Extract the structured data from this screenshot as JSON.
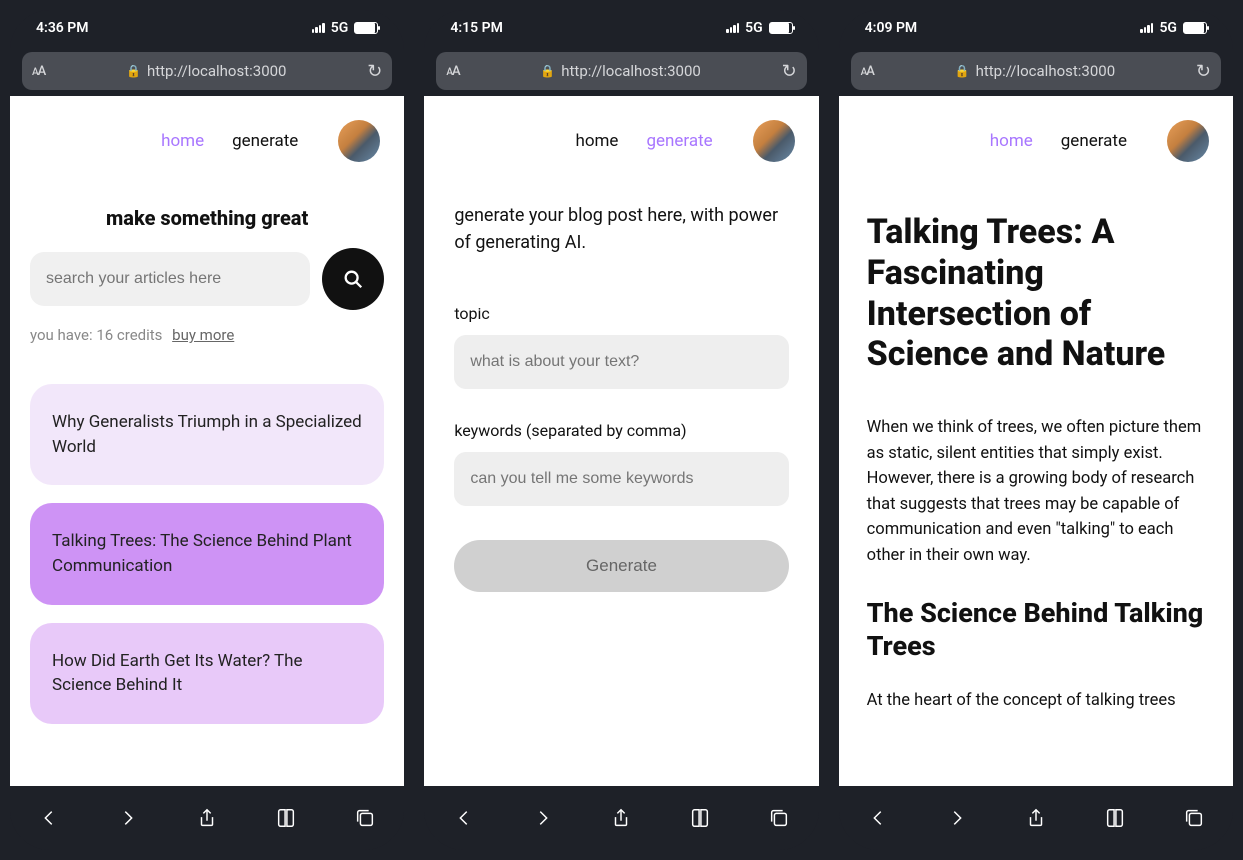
{
  "network": {
    "type": "5G"
  },
  "url_bar": {
    "url": "http://localhost:3000",
    "text_size_label": "AA"
  },
  "nav": {
    "home": "home",
    "generate": "generate"
  },
  "screens": [
    {
      "time": "4:36 PM",
      "active_nav": "home",
      "title": "make something great",
      "search_placeholder": "search your articles here",
      "credits_prefix": "you have: ",
      "credits_count": "16 credits",
      "buy_more": "buy more",
      "cards": [
        "Why Generalists Triumph in a Specialized World",
        "Talking Trees: The Science Behind Plant Communication",
        "How Did Earth Get Its Water? The Science Behind It"
      ]
    },
    {
      "time": "4:15 PM",
      "active_nav": "generate",
      "intro": "generate your blog post here, with power of generating AI.",
      "topic_label": "topic",
      "topic_placeholder": "what is about your text?",
      "keywords_label": "keywords (separated by comma)",
      "keywords_placeholder": "can you tell me some keywords",
      "generate_button": "Generate"
    },
    {
      "time": "4:09 PM",
      "active_nav": "home",
      "article": {
        "title": "Talking Trees: A Fascinating Intersection of Science and Nature",
        "para1": "When we think of trees, we often picture them as static, silent entities that simply exist. However, there is a growing body of research that suggests that trees may be capable of communication and even \"talking\" to each other in their own way.",
        "h2": "The Science Behind Talking Trees",
        "para2": "At the heart of the concept of talking trees"
      }
    }
  ]
}
